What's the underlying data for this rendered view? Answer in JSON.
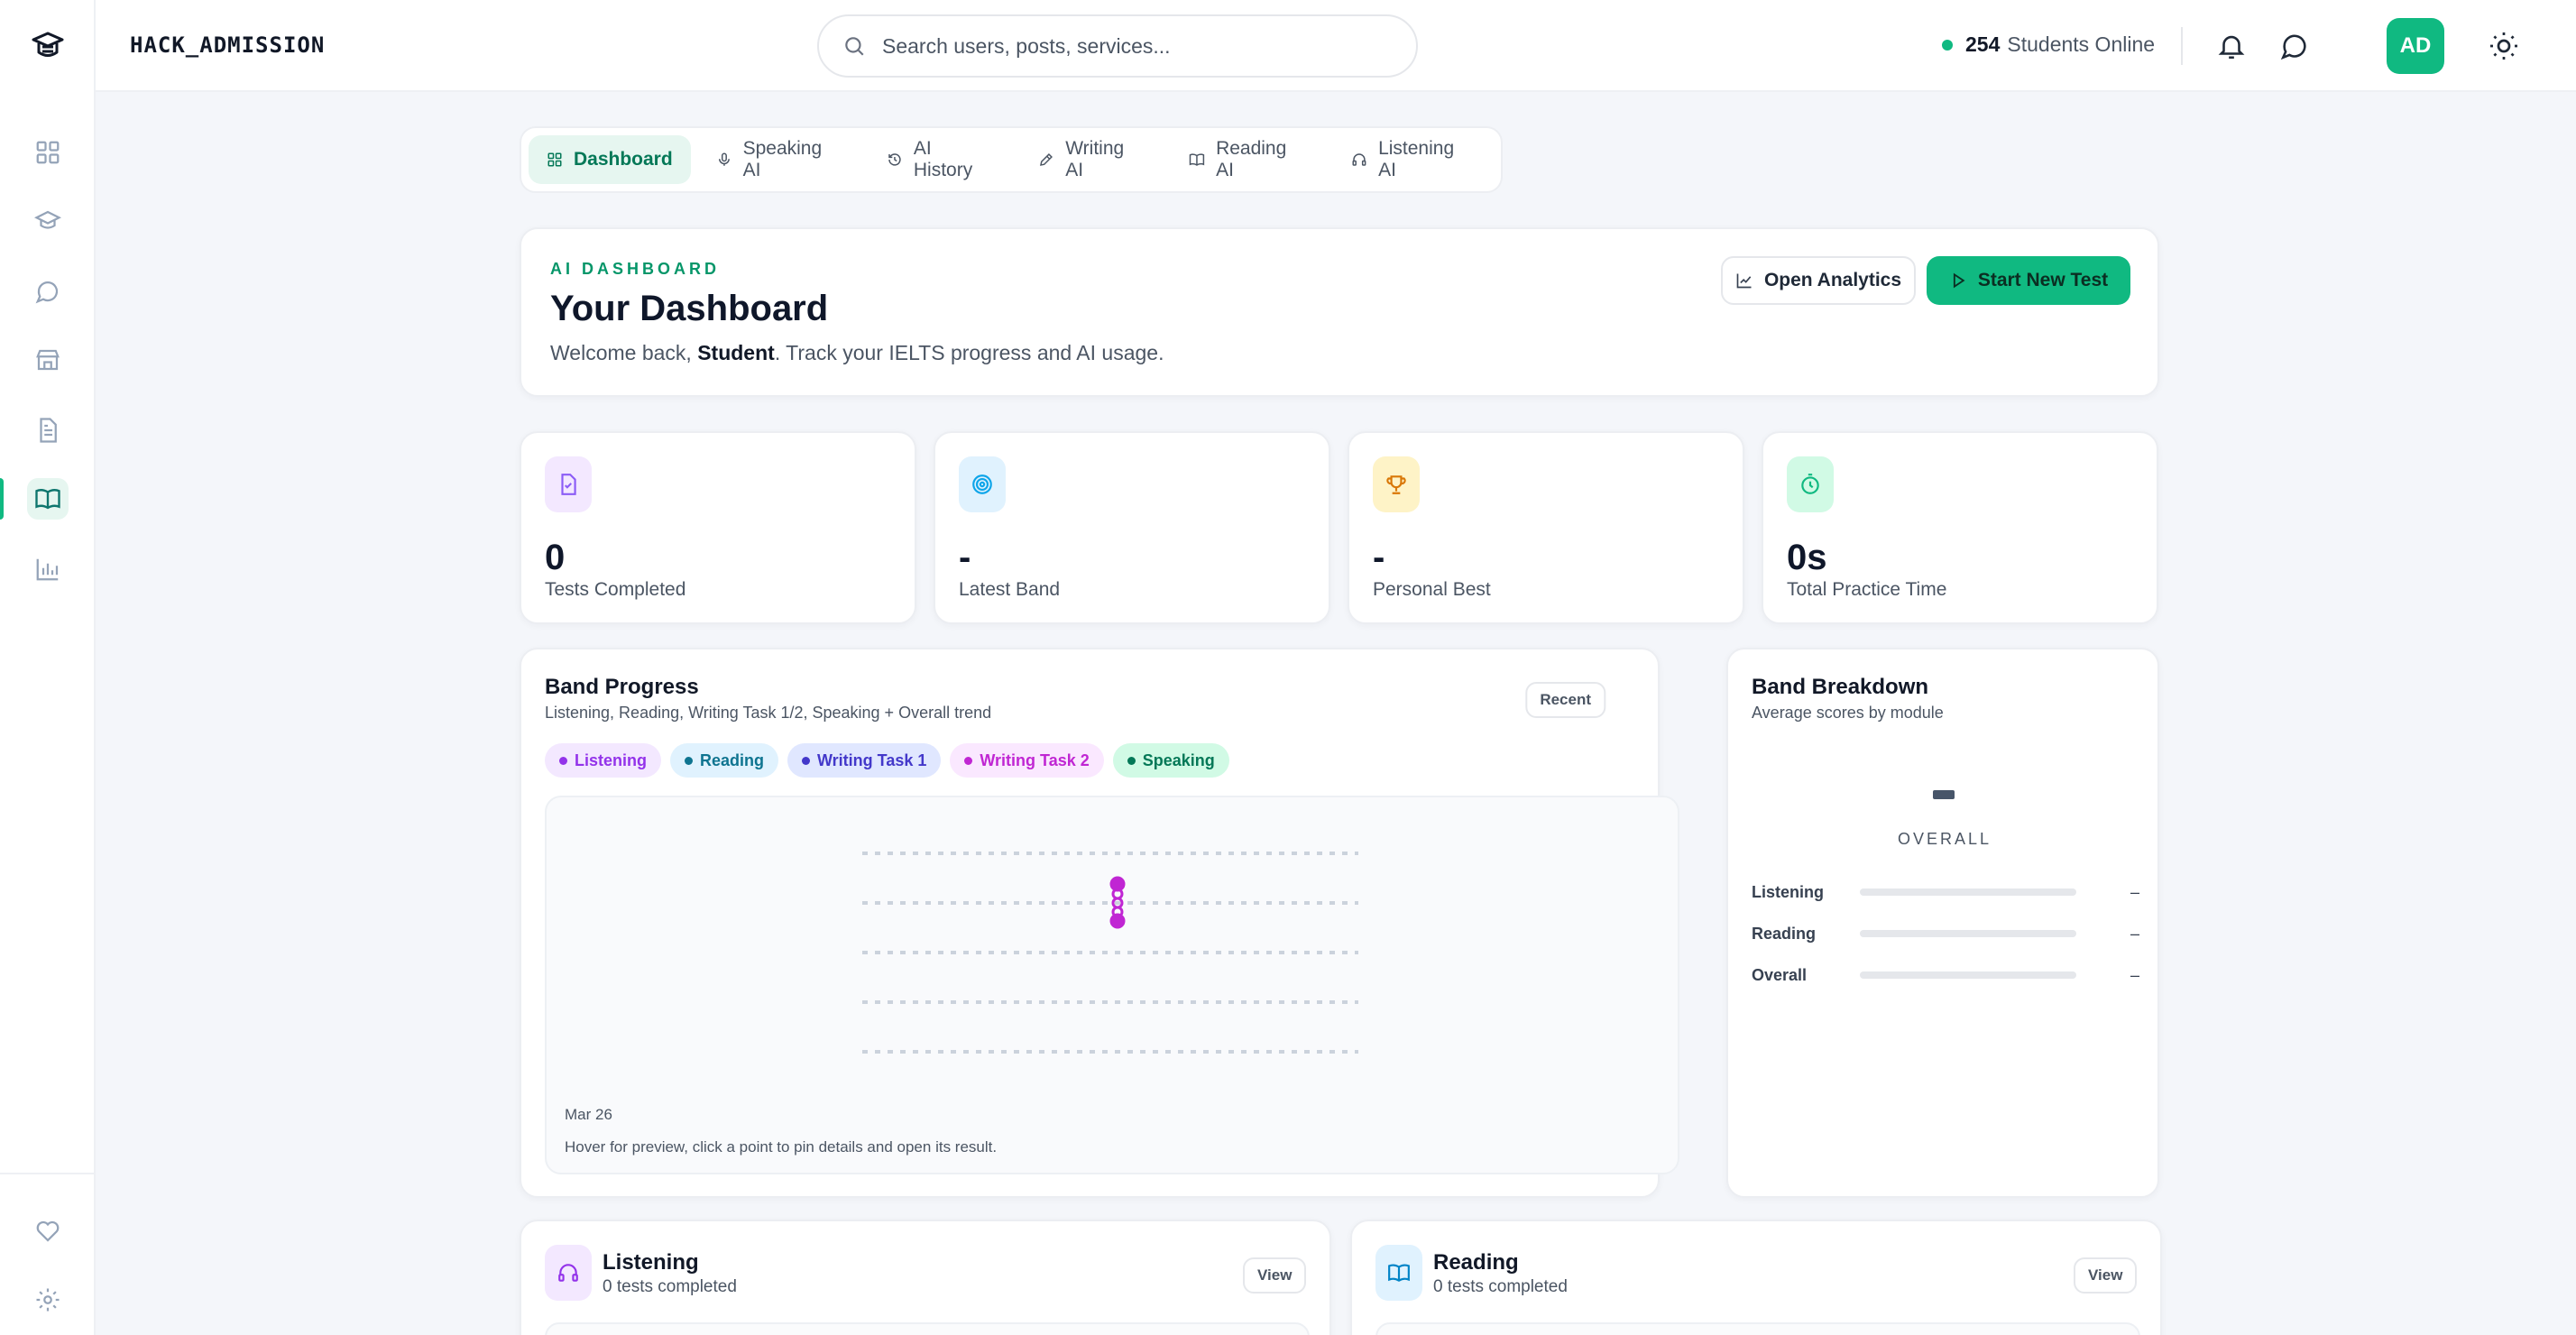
{
  "app": {
    "brand": "HACK_ADMISSION"
  },
  "search": {
    "placeholder": "Search users, posts, services..."
  },
  "online": {
    "count": "254",
    "label": "Students Online"
  },
  "user": {
    "initials": "AD"
  },
  "sidebar": {
    "items": [
      {
        "icon": "grid-icon"
      },
      {
        "icon": "graduation-cap-icon"
      },
      {
        "icon": "chat-icon"
      },
      {
        "icon": "store-icon"
      },
      {
        "icon": "document-icon"
      },
      {
        "icon": "book-open-icon",
        "active": true
      },
      {
        "icon": "bar-chart-icon"
      }
    ],
    "bottom": [
      {
        "icon": "heart-icon"
      },
      {
        "icon": "settings-icon"
      }
    ]
  },
  "tabs": [
    {
      "label": "Dashboard",
      "icon": "grid-icon",
      "active": true
    },
    {
      "label": "Speaking AI",
      "icon": "mic-icon"
    },
    {
      "label": "AI History",
      "icon": "history-icon"
    },
    {
      "label": "Writing AI",
      "icon": "pen-icon"
    },
    {
      "label": "Reading AI",
      "icon": "book-icon"
    },
    {
      "label": "Listening AI",
      "icon": "headphones-icon"
    }
  ],
  "hero": {
    "eyebrow": "AI DASHBOARD",
    "title": "Your Dashboard",
    "welcome_prefix": "Welcome back, ",
    "user_name": "Student",
    "welcome_suffix": ". Track your IELTS progress and AI usage.",
    "open_analytics": "Open Analytics",
    "start_new_test": "Start New Test"
  },
  "stats": [
    {
      "value": "0",
      "label": "Tests Completed",
      "icon": "file-icon",
      "color": "#8b5cf6"
    },
    {
      "value": "-",
      "label": "Latest Band",
      "icon": "target-icon",
      "color": "#0ea5e9"
    },
    {
      "value": "-",
      "label": "Personal Best",
      "icon": "trophy-icon",
      "color": "#d97706"
    },
    {
      "value": "0s",
      "label": "Total Practice Time",
      "icon": "timer-icon",
      "color": "#10b981"
    }
  ],
  "band_progress": {
    "title": "Band Progress",
    "subtitle": "Listening, Reading, Writing Task 1/2, Speaking + Overall trend",
    "filter": "Recent",
    "date_label": "Mar 26",
    "hint": "Hover for preview, click a point to pin details and open its result.",
    "legend": [
      {
        "name": "Listening",
        "color": "#9333ea",
        "bg": "#f3e8ff"
      },
      {
        "name": "Reading",
        "color": "#0e7490",
        "bg": "#e0f2fe"
      },
      {
        "name": "Writing Task 1",
        "color": "#4338ca",
        "bg": "#e0e7ff"
      },
      {
        "name": "Writing Task 2",
        "color": "#c026d3",
        "bg": "#fae8ff"
      },
      {
        "name": "Speaking",
        "color": "#047857",
        "bg": "#d1fae5"
      }
    ]
  },
  "chart_data": {
    "type": "line",
    "x": [
      "Mar 26"
    ],
    "series": [
      {
        "name": "Listening",
        "values": [
          null
        ]
      },
      {
        "name": "Reading",
        "values": [
          null
        ]
      },
      {
        "name": "Writing Task 1",
        "values": [
          null
        ]
      },
      {
        "name": "Writing Task 2",
        "values": [
          null
        ]
      },
      {
        "name": "Speaking",
        "values": [
          null
        ]
      }
    ],
    "grid": true
  },
  "band_breakdown": {
    "title": "Band Breakdown",
    "subtitle": "Average scores by module",
    "overall_label": "OVERALL",
    "rows": [
      {
        "name": "Listening",
        "value": "–"
      },
      {
        "name": "Reading",
        "value": "–"
      },
      {
        "name": "Overall",
        "value": "–"
      }
    ]
  },
  "modules": [
    {
      "title": "Listening",
      "subtitle": "0 tests completed",
      "action": "View",
      "icon": "headphones-icon"
    },
    {
      "title": "Reading",
      "subtitle": "0 tests completed",
      "action": "View",
      "icon": "book-open-icon"
    }
  ]
}
